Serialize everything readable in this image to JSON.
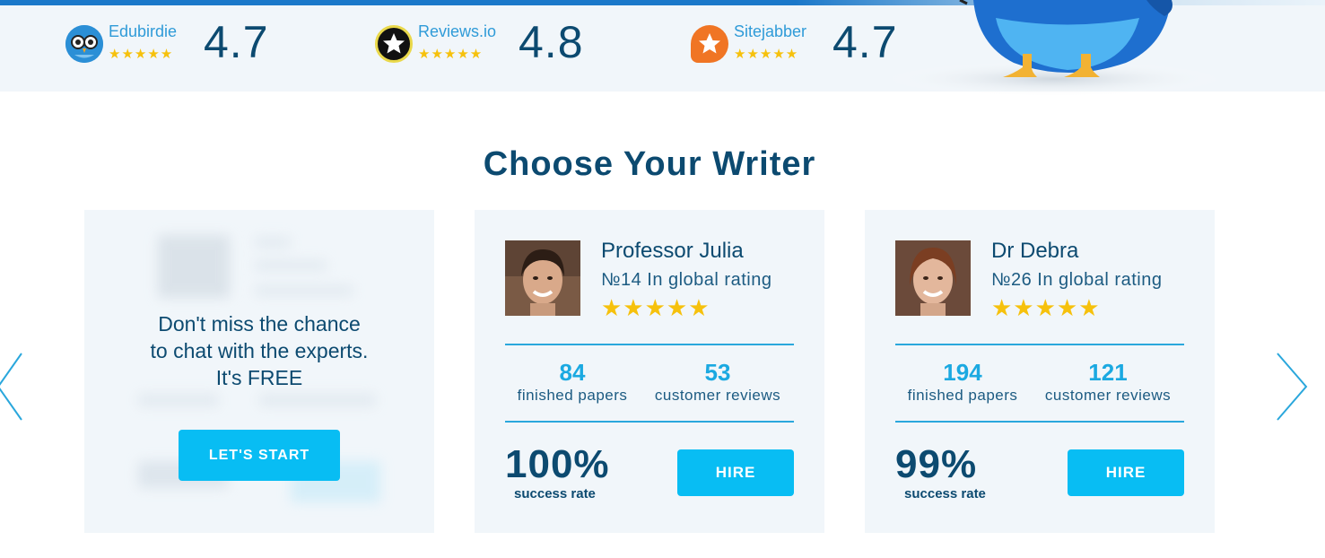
{
  "ratings": [
    {
      "name": "Edubirdie",
      "stars": "★★★★★",
      "score": "4.7",
      "logo": "edubirdie-owl-icon"
    },
    {
      "name": "Reviews.io",
      "stars": "★★★★★",
      "score": "4.8",
      "logo": "star-badge-icon"
    },
    {
      "name": "Sitejabber",
      "stars": "★★★★★",
      "score": "4.7",
      "logo": "speech-star-icon"
    }
  ],
  "section": {
    "title": "Choose Your Writer"
  },
  "promo": {
    "line1": "Don't miss the chance",
    "line2": "to chat with the experts.",
    "line3": "It's FREE",
    "button": "LET'S START"
  },
  "writers": [
    {
      "name": "Professor Julia",
      "rank": "№14 In global rating",
      "stars": "★★★★★",
      "papers": "84",
      "papers_label": "finished papers",
      "reviews": "53",
      "reviews_label": "customer reviews",
      "success": "100%",
      "success_label": "success rate",
      "hire": "HIRE"
    },
    {
      "name": "Dr Debra",
      "rank": "№26 In global rating",
      "stars": "★★★★★",
      "papers": "194",
      "papers_label": "finished papers",
      "reviews": "121",
      "reviews_label": "customer reviews",
      "success": "99%",
      "success_label": "success rate",
      "hire": "HIRE"
    }
  ],
  "colors": {
    "accent": "#08bdf3",
    "navy": "#0c4a70",
    "star": "#f6c10c",
    "card": "#f1f6fa"
  }
}
